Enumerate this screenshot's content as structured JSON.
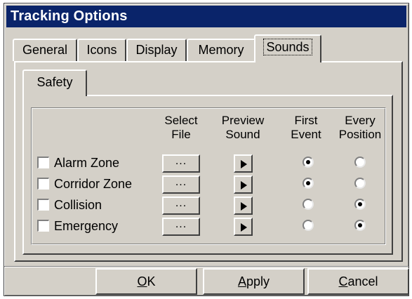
{
  "window": {
    "title": "Tracking Options"
  },
  "tabs": [
    {
      "label": "General",
      "active": false
    },
    {
      "label": "Icons",
      "active": false
    },
    {
      "label": "Display",
      "active": false
    },
    {
      "label": "Memory",
      "active": false
    },
    {
      "label": "Sounds",
      "active": true
    }
  ],
  "subtabs": [
    {
      "label": "Safety",
      "active": true
    }
  ],
  "columns": {
    "select_file": [
      "Select",
      "File"
    ],
    "preview_sound": [
      "Preview",
      "Sound"
    ],
    "first_event": [
      "First",
      "Event"
    ],
    "every_position": [
      "Every",
      "Position"
    ]
  },
  "rows": [
    {
      "label": "Alarm Zone",
      "checked": false,
      "select_label": "...",
      "mode": "first_event"
    },
    {
      "label": "Corridor Zone",
      "checked": false,
      "select_label": "...",
      "mode": "first_event"
    },
    {
      "label": "Collision",
      "checked": false,
      "select_label": "...",
      "mode": "every_position"
    },
    {
      "label": "Emergency",
      "checked": false,
      "select_label": "...",
      "mode": "every_position"
    }
  ],
  "buttons": {
    "ok": {
      "pre": "",
      "accel": "O",
      "post": "K"
    },
    "apply": {
      "pre": "",
      "accel": "A",
      "post": "pply"
    },
    "cancel": {
      "pre": "",
      "accel": "C",
      "post": "ancel"
    }
  },
  "colors": {
    "title_bar": "#0a246a",
    "face": "#d4d0c8"
  }
}
